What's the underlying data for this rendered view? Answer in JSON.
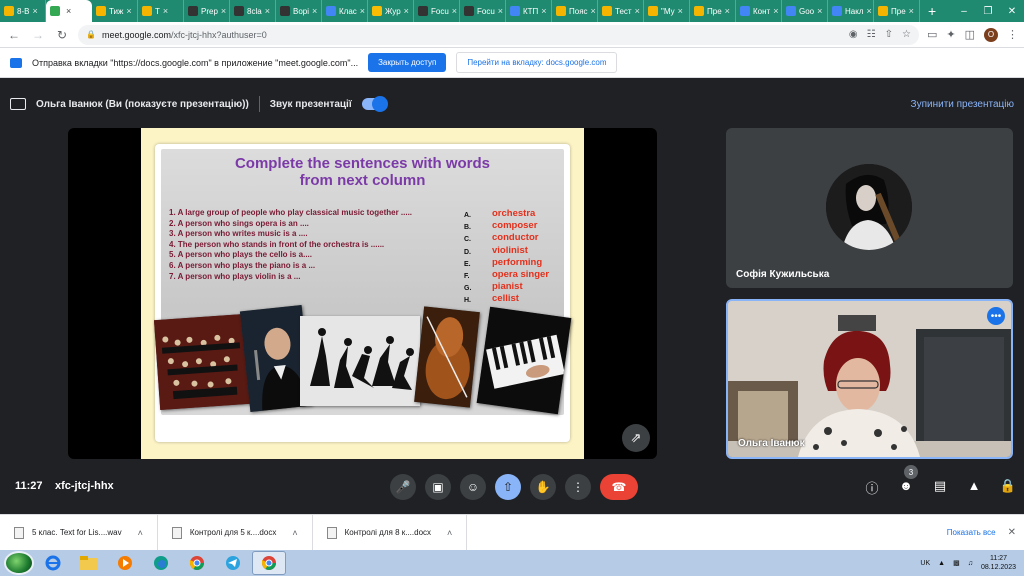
{
  "tabs": [
    {
      "label": "8-В",
      "color": "#f4b400",
      "active": false
    },
    {
      "label": "",
      "color": "#34a853",
      "active": true
    },
    {
      "label": "Тиж",
      "color": "#f4b400",
      "active": false
    },
    {
      "label": "Т",
      "color": "#f4b400",
      "active": false
    },
    {
      "label": "Prep",
      "color": "#333333",
      "active": false
    },
    {
      "label": "8cla",
      "color": "#333333",
      "active": false
    },
    {
      "label": "Вopi",
      "color": "#333333",
      "active": false
    },
    {
      "label": "Клас",
      "color": "#4285f4",
      "active": false
    },
    {
      "label": "Жур",
      "color": "#fbbc04",
      "active": false
    },
    {
      "label": "Focu",
      "color": "#333333",
      "active": false
    },
    {
      "label": "Focu",
      "color": "#333333",
      "active": false
    },
    {
      "label": "КТП",
      "color": "#4285f4",
      "active": false
    },
    {
      "label": "Пояс",
      "color": "#f4b400",
      "active": false
    },
    {
      "label": "Тест",
      "color": "#f4b400",
      "active": false
    },
    {
      "label": "\"Му",
      "color": "#f4b400",
      "active": false
    },
    {
      "label": "Пре",
      "color": "#f4b400",
      "active": false
    },
    {
      "label": "Конт",
      "color": "#4285f4",
      "active": false
    },
    {
      "label": "Goo",
      "color": "#4285f4",
      "active": false
    },
    {
      "label": "Накл",
      "color": "#4285f4",
      "active": false
    },
    {
      "label": "Пре",
      "color": "#f4b400",
      "active": false
    }
  ],
  "address": {
    "host": "meet.google.com",
    "path": "/xfc-jtcj-hhx?authuser=0",
    "profile_initial": "O"
  },
  "infobar": {
    "text": "Отправка вкладки \"https://docs.google.com\" в приложение \"meet.google.com\"...",
    "stop_button": "Закрыть доступ",
    "switch_button": "Перейти на вкладку: docs.google.com"
  },
  "presenting": {
    "presenter": "Ольга Іванюк (Ви (показуєте презентацію))",
    "sound_label": "Звук презентації",
    "stop_label": "Зупинити презентацію"
  },
  "slide": {
    "title_line1": "Complete the sentences with words",
    "title_line2": "from next column",
    "questions": [
      "1. A large group of people who play classical music together .....",
      "2. A person who sings opera is an ....",
      "3. A person who writes music is a ....",
      "4. The person who stands in front of the orchestra is ......",
      "5. A person who plays the cello is a....",
      "6. A person who plays the piano is a ...",
      "7. A person who plays violin is a ..."
    ],
    "letters": [
      "A.",
      "B.",
      "C.",
      "D.",
      "E.",
      "F.",
      "G.",
      "H."
    ],
    "answers": [
      "orchestra",
      "composer",
      "conductor",
      "violinist",
      "performing",
      "opera singer",
      "pianist",
      "cellist"
    ]
  },
  "participants": [
    {
      "name": "Софія Кужильська"
    },
    {
      "name": "Ольга Іванюк"
    }
  ],
  "meeting": {
    "time": "11:27",
    "code": "xfc-jtcj-hhx",
    "participant_count": "3"
  },
  "downloads": [
    {
      "name": "5 клас. Text for Lis....wav"
    },
    {
      "name": "Контролі для 5 к....docx"
    },
    {
      "name": "Контролі для 8 к....docx"
    }
  ],
  "download_show_all": "Показать все",
  "tray": {
    "lang": "UK",
    "time": "11:27",
    "date": "08.12.2023"
  }
}
